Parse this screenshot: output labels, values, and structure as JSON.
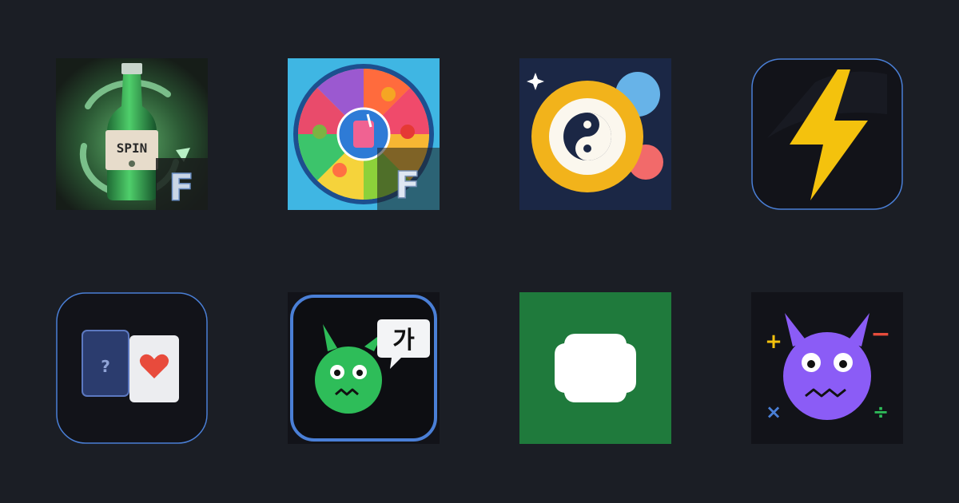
{
  "apps": [
    {
      "icon": "spin-bottle-icon",
      "bottle_label": "SPIN",
      "badge": "F"
    },
    {
      "icon": "fruit-wheel-icon",
      "badge": "F"
    },
    {
      "icon": "yin-yang-ball-icon"
    },
    {
      "icon": "lightning-bolt-icon"
    },
    {
      "icon": "card-guess-icon",
      "card_mark": "?"
    },
    {
      "icon": "monster-korean-icon",
      "bubble_text": "가"
    },
    {
      "icon": "blank-rounded-square-icon"
    },
    {
      "icon": "math-monster-icon",
      "symbols": [
        "+",
        "−",
        "×",
        "÷"
      ]
    }
  ],
  "colors": {
    "background": "#1b1e25",
    "tile_dark": "#121319",
    "accent_blue": "#4a7fd6",
    "green_tile": "#1f7a3c",
    "monster_green": "#2ebd59",
    "monster_purple": "#8b5cf6",
    "bolt_yellow": "#f4c20d",
    "ball_yellow": "#f2b31b"
  }
}
